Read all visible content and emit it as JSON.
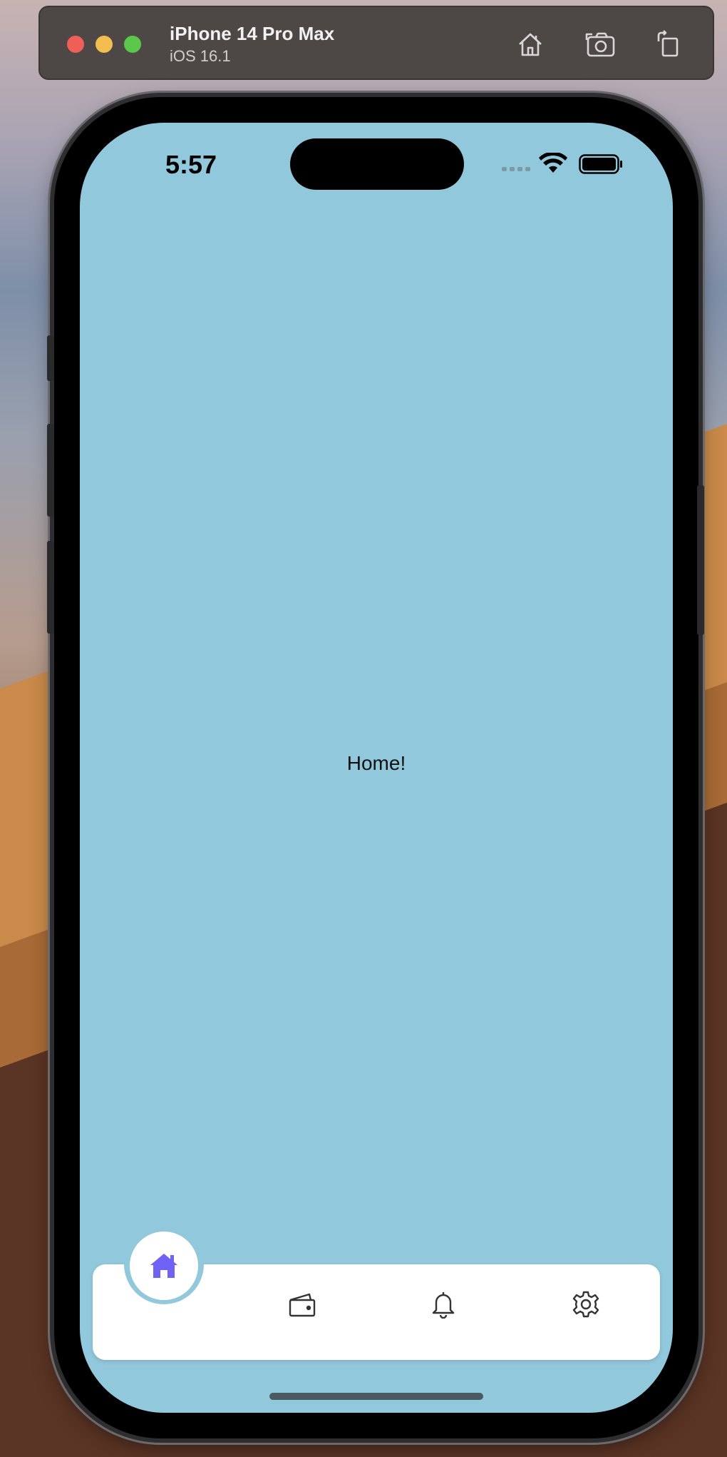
{
  "simulator": {
    "device_name": "iPhone 14 Pro Max",
    "os_version": "iOS 16.1",
    "toolbar_icons": [
      "home-icon",
      "screenshot-icon",
      "rotate-icon"
    ]
  },
  "status_bar": {
    "time": "5:57",
    "icons": [
      "cellular-signal-icon",
      "wifi-icon",
      "battery-icon"
    ]
  },
  "screen": {
    "background_color": "#92c8db",
    "content_text": "Home!"
  },
  "tab_bar": {
    "active_color": "#6f62f5",
    "inactive_color": "#333333",
    "tabs": [
      {
        "icon": "home-icon",
        "active": true
      },
      {
        "icon": "wallet-icon",
        "active": false
      },
      {
        "icon": "bell-icon",
        "active": false
      },
      {
        "icon": "gear-icon",
        "active": false
      }
    ]
  }
}
